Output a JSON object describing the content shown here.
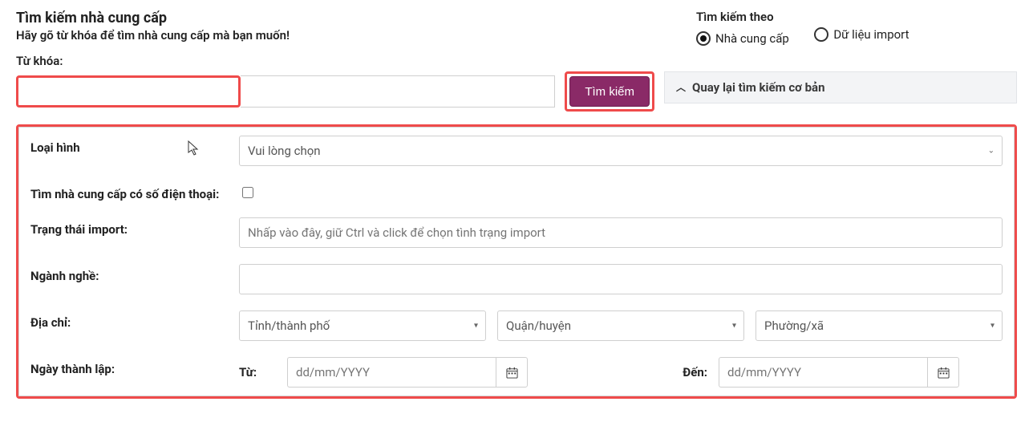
{
  "header": {
    "title": "Tìm kiếm nhà cung cấp",
    "subtitle": "Hãy gõ từ khóa để tìm nhà cung cấp mà bạn muốn!",
    "keyword_label": "Từ khóa:"
  },
  "search_by": {
    "label": "Tìm kiếm theo",
    "options": [
      "Nhà cung cấp",
      "Dữ liệu import"
    ],
    "selected": 0
  },
  "actions": {
    "search": "Tìm kiếm",
    "toggle_basic": "Quay lại tìm kiếm cơ bản"
  },
  "advanced": {
    "type": {
      "label": "Loại hình",
      "placeholder": "Vui lòng chọn"
    },
    "has_phone": {
      "label": "Tìm nhà cung cấp có số điện thoại:",
      "checked": false
    },
    "import_status": {
      "label": "Trạng thái import:",
      "placeholder": "Nhấp vào đây, giữ Ctrl và click để chọn tình trạng import"
    },
    "industry": {
      "label": "Ngành nghề:"
    },
    "address": {
      "label": "Địa chỉ:",
      "province": "Tỉnh/thành phố",
      "district": "Quận/huyện",
      "ward": "Phường/xã"
    },
    "established": {
      "label": "Ngày thành lập:",
      "from": "Từ:",
      "to": "Đến:",
      "placeholder": "dd/mm/YYYY"
    }
  }
}
